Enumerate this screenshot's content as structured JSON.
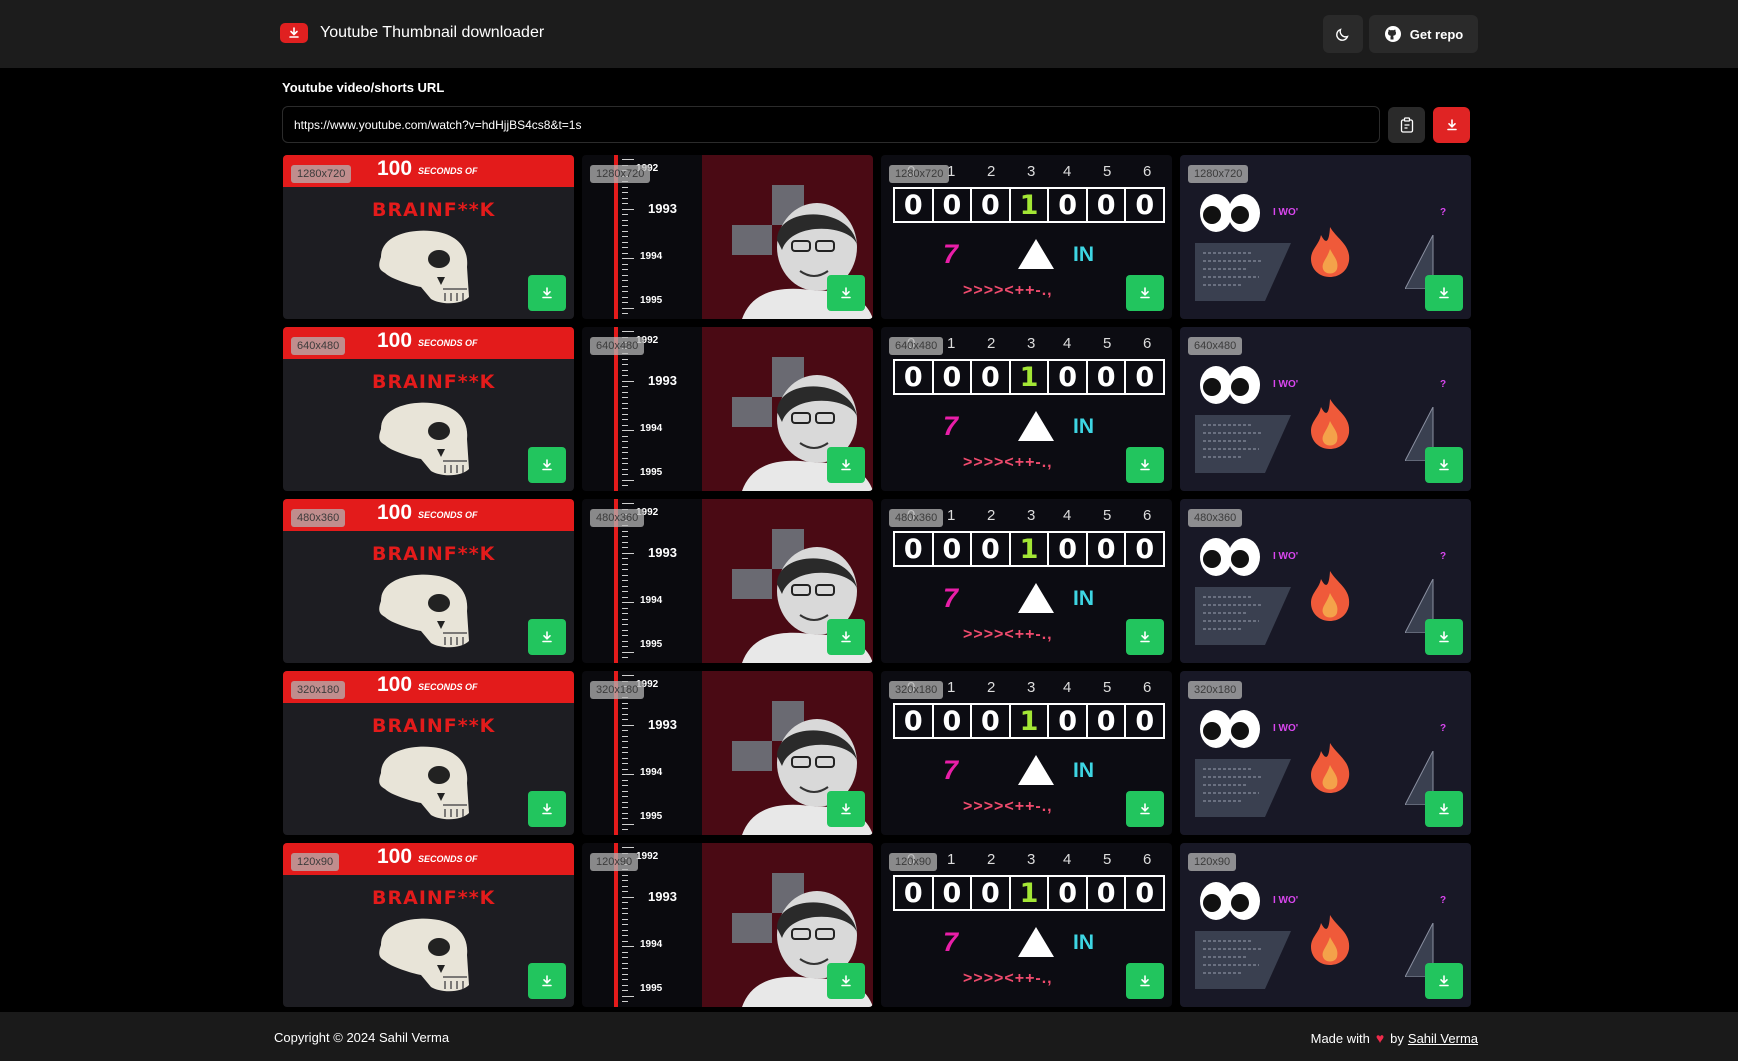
{
  "header": {
    "title": "Youtube Thumbnail downloader",
    "logo_icon": "youtube-download-icon",
    "theme_icon": "moon-icon",
    "repo_label": "Get repo",
    "repo_icon": "github-icon"
  },
  "form": {
    "label": "Youtube video/shorts URL",
    "url_value": "https://www.youtube.com/watch?v=hdHjjBS4cs8&t=1s",
    "paste_icon": "clipboard-icon",
    "fetch_icon": "download-icon"
  },
  "resolutions": [
    "1280x720",
    "640x480",
    "480x360",
    "320x180",
    "120x90"
  ],
  "thumb1": {
    "number": "100",
    "seconds": "SECONDS OF",
    "title": "BRAINF**K"
  },
  "thumb2": {
    "years": [
      "1992",
      "1993",
      "1994",
      "1995"
    ]
  },
  "thumb3": {
    "indices": [
      "0",
      "1",
      "2",
      "3",
      "4",
      "5",
      "6"
    ],
    "cells": [
      "0",
      "0",
      "0",
      "1",
      "0",
      "0",
      "0"
    ],
    "seven": "7",
    "in_label": "IN",
    "code": ">>>><++-.,"
  },
  "thumb4": {
    "label_a": "I WO'",
    "label_b": "?"
  },
  "colors": {
    "accent_red": "#e02424",
    "download_green": "#22c55e",
    "header_bg": "#1c1c1c"
  },
  "footer": {
    "copyright": "Copyright © 2024 Sahil Verma",
    "made_with": "Made with",
    "by": "by",
    "author": "Sahil Verma",
    "heart_icon": "heart-icon"
  }
}
